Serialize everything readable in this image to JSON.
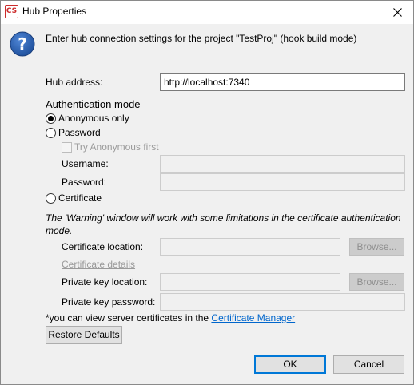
{
  "window": {
    "app_icon_text": "CS",
    "title": "Hub Properties"
  },
  "header": {
    "message": "Enter hub connection settings for the project \"TestProj\" (hook build mode)"
  },
  "hub": {
    "label": "Hub address:",
    "value": "http://localhost:7340"
  },
  "auth": {
    "heading": "Authentication mode",
    "anonymous_label": "Anonymous only",
    "password_label": "Password",
    "try_anonymous_label": "Try Anonymous first",
    "username_label": "Username:",
    "username_value": "",
    "password_field_label": "Password:",
    "password_value": "",
    "certificate_label": "Certificate",
    "selected": "Anonymous only"
  },
  "certificate": {
    "warning": "The 'Warning' window will work with some limitations in the certificate authentication mode.",
    "location_label": "Certificate location:",
    "location_value": "",
    "browse_label": "Browse...",
    "details_label": "Certificate details",
    "private_key_location_label": "Private key location:",
    "private_key_location_value": "",
    "browse_label_2": "Browse...",
    "private_key_password_label": "Private key password:",
    "private_key_password_value": ""
  },
  "footer": {
    "note_prefix": "*you can view server certificates in the ",
    "note_link": "Certificate Manager",
    "restore_label": "Restore Defaults",
    "ok_label": "OK",
    "cancel_label": "Cancel"
  },
  "colors": {
    "accent": "#0078d7",
    "link": "#0066cc",
    "app_icon": "#cc2b2b",
    "info_icon": "#2b5ba8"
  }
}
